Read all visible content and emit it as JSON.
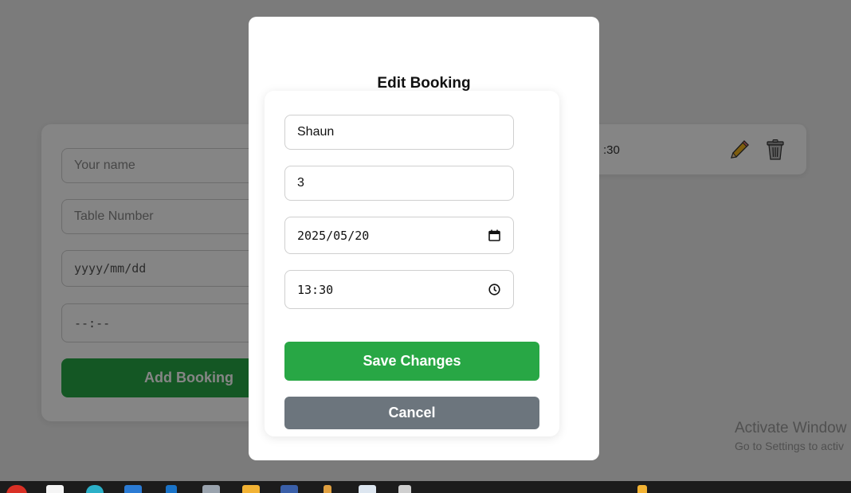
{
  "background_form": {
    "name_placeholder": "Your name",
    "table_placeholder": "Table Number",
    "date_placeholder": "yyyy/mm/dd",
    "time_placeholder": "--:--",
    "add_button_label": "Add Booking"
  },
  "background_list": {
    "item_time_text": ":30",
    "edit_icon": "pencil-icon",
    "delete_icon": "trash-icon"
  },
  "modal": {
    "title": "Edit Booking",
    "name_value": "Shaun",
    "table_value": "3",
    "date_value": "2025/05/20",
    "time_value": "13:30",
    "save_label": "Save Changes",
    "cancel_label": "Cancel",
    "calendar_icon": "calendar-icon",
    "clock_icon": "clock-icon"
  },
  "watermark": {
    "line1": "Activate Window",
    "line2": "Go to Settings to activ"
  },
  "colors": {
    "accent_green": "#28a745",
    "cancel_gray": "#6c757d"
  }
}
